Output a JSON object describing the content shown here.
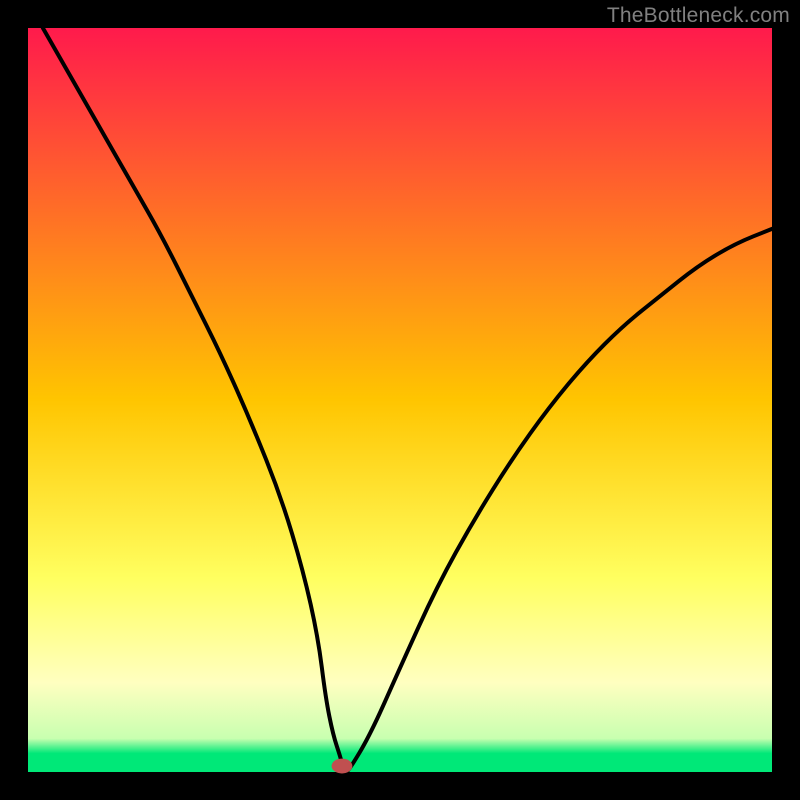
{
  "watermark": "TheBottleneck.com",
  "chart_data": {
    "type": "line",
    "title": "",
    "xlabel": "",
    "ylabel": "",
    "xlim": [
      0,
      100
    ],
    "ylim": [
      0,
      100
    ],
    "background_gradient_stops": [
      {
        "offset": 0.0,
        "color": "#ff1a4c"
      },
      {
        "offset": 0.5,
        "color": "#ffc500"
      },
      {
        "offset": 0.74,
        "color": "#ffff60"
      },
      {
        "offset": 0.88,
        "color": "#ffffc0"
      },
      {
        "offset": 0.955,
        "color": "#c8ffb0"
      },
      {
        "offset": 0.975,
        "color": "#00e878"
      }
    ],
    "series": [
      {
        "name": "bottleneck-curve",
        "x": [
          2,
          6,
          10,
          14,
          18,
          22,
          26,
          30,
          34,
          37,
          39,
          40,
          41,
          42,
          42.5,
          43,
          46,
          50,
          55,
          60,
          65,
          70,
          75,
          80,
          85,
          90,
          95,
          100
        ],
        "y": [
          100,
          93,
          86,
          79,
          72,
          64,
          56,
          47,
          37,
          27,
          18,
          10,
          5,
          2,
          0,
          0,
          5,
          14,
          25,
          34,
          42,
          49,
          55,
          60,
          64,
          68,
          71,
          73
        ]
      }
    ],
    "null_point_marker": {
      "x": 42.2,
      "y": 0.8,
      "rx": 1.4,
      "ry": 1.0,
      "color": "#c05050"
    },
    "frame_color": "#000000",
    "frame_inset_percent": 3.5
  }
}
